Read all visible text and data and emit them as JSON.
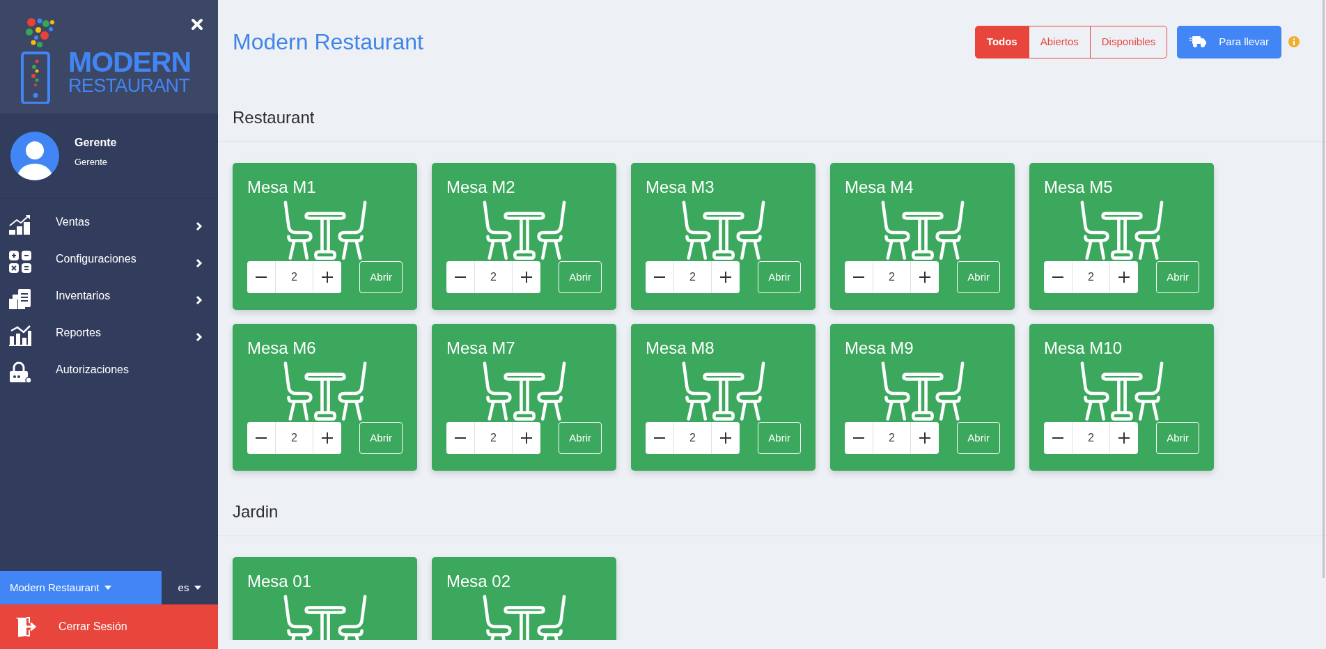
{
  "sidebar": {
    "logo": {
      "line_1": "MODERN",
      "line_2": "RESTAURANT"
    },
    "user": {
      "name": "Gerente",
      "role": "Gerente"
    },
    "menu": [
      {
        "label": "Ventas",
        "expandable": true
      },
      {
        "label": "Configuraciones",
        "expandable": true
      },
      {
        "label": "Inventarios",
        "expandable": true
      },
      {
        "label": "Reportes",
        "expandable": true
      },
      {
        "label": "Autorizaciones",
        "expandable": false
      }
    ],
    "restaurant_selector": "Modern Restaurant",
    "language_selector": "es",
    "logout": "Cerrar Sesión"
  },
  "header": {
    "title": "Modern Restaurant",
    "filters": [
      {
        "label": "Todos",
        "selected": true
      },
      {
        "label": "Abiertos",
        "selected": false
      },
      {
        "label": "Disponibles",
        "selected": false
      }
    ],
    "takeaway_button": "Para llevar"
  },
  "sections": [
    {
      "title": "Restaurant",
      "tables": [
        {
          "name": "Mesa M1",
          "guests": "2",
          "action": "Abrir"
        },
        {
          "name": "Mesa M2",
          "guests": "2",
          "action": "Abrir"
        },
        {
          "name": "Mesa M3",
          "guests": "2",
          "action": "Abrir"
        },
        {
          "name": "Mesa M4",
          "guests": "2",
          "action": "Abrir"
        },
        {
          "name": "Mesa M5",
          "guests": "2",
          "action": "Abrir"
        },
        {
          "name": "Mesa M6",
          "guests": "2",
          "action": "Abrir"
        },
        {
          "name": "Mesa M7",
          "guests": "2",
          "action": "Abrir"
        },
        {
          "name": "Mesa M8",
          "guests": "2",
          "action": "Abrir"
        },
        {
          "name": "Mesa M9",
          "guests": "2",
          "action": "Abrir"
        },
        {
          "name": "Mesa M10",
          "guests": "2",
          "action": "Abrir"
        }
      ]
    },
    {
      "title": "Jardin",
      "tables": [
        {
          "name": "Mesa 01"
        },
        {
          "name": "Mesa 02"
        }
      ]
    }
  ]
}
